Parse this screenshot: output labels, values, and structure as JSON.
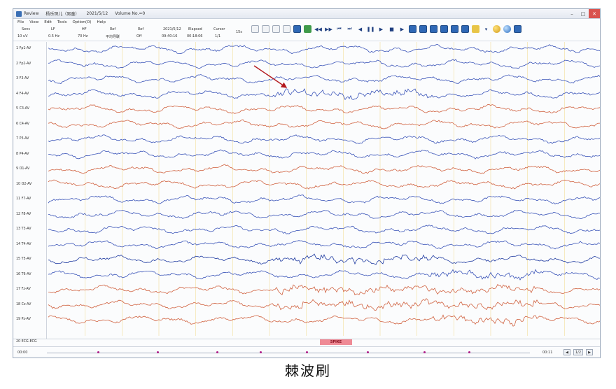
{
  "window": {
    "title_parts": [
      "Review",
      "杨乐琛儿（男童）",
      "2021/5/12",
      "Volume No.=0"
    ]
  },
  "menu": [
    "File",
    "View",
    "Edit",
    "Tools",
    "Option(O)",
    "Help"
  ],
  "controls": {
    "labels": [
      "Sens",
      "LF",
      "HF",
      "Ref",
      "Ref",
      "2021/5/12",
      "Elapsed",
      "Cursor"
    ],
    "values": [
      "10 uV",
      "0.5 Hz",
      "70 Hz",
      "平均导联",
      "Off",
      "09:40:16",
      "00:18:06",
      "1/1"
    ],
    "speed": "15s"
  },
  "toolbar_icons": [
    {
      "name": "open-icon",
      "style": "doc",
      "glyph": ""
    },
    {
      "name": "save-icon",
      "style": "doc",
      "glyph": ""
    },
    {
      "name": "copy-icon",
      "style": "doc",
      "glyph": ""
    },
    {
      "name": "print-icon",
      "style": "doc",
      "glyph": ""
    },
    {
      "name": "montage-icon",
      "style": "img",
      "glyph": ""
    },
    {
      "name": "report-icon",
      "style": "green",
      "glyph": ""
    },
    {
      "name": "rewind-fast-icon",
      "style": "plain",
      "glyph": "◀◀"
    },
    {
      "name": "forward-fast-icon",
      "style": "plain",
      "glyph": "▶▶"
    },
    {
      "name": "skip-back-icon",
      "style": "plain",
      "glyph": "⏮"
    },
    {
      "name": "skip-forward-icon",
      "style": "plain",
      "glyph": "⏭"
    },
    {
      "name": "step-back-icon",
      "style": "plain",
      "glyph": "◀"
    },
    {
      "name": "pause-icon",
      "style": "plain",
      "glyph": "❚❚"
    },
    {
      "name": "step-forward-icon",
      "style": "plain",
      "glyph": "▶"
    },
    {
      "name": "stop-icon",
      "style": "plain",
      "glyph": "■"
    },
    {
      "name": "play-icon",
      "style": "plain",
      "glyph": "▶"
    },
    {
      "name": "spectrum-icon",
      "style": "img",
      "glyph": ""
    },
    {
      "name": "map-icon",
      "style": "img",
      "glyph": ""
    },
    {
      "name": "video-icon",
      "style": "img",
      "glyph": ""
    },
    {
      "name": "camera-icon",
      "style": "img",
      "glyph": ""
    },
    {
      "name": "mark-icon",
      "style": "img",
      "glyph": ""
    },
    {
      "name": "event-icon",
      "style": "img",
      "glyph": ""
    },
    {
      "name": "folder-icon",
      "style": "yellow",
      "glyph": ""
    },
    {
      "name": "settings-icon",
      "style": "plain",
      "glyph": "▾"
    },
    {
      "name": "bulb-icon",
      "style": "ball",
      "glyph": ""
    },
    {
      "name": "globe-icon",
      "style": "ball2",
      "glyph": ""
    },
    {
      "name": "tools-icon",
      "style": "img",
      "glyph": ""
    }
  ],
  "channels": [
    {
      "label": "1 Fp1-AV",
      "color": "#3a54b8"
    },
    {
      "label": "2 Fp2-AV",
      "color": "#3a54b8"
    },
    {
      "label": "3 F3-AV",
      "color": "#3a54b8"
    },
    {
      "label": "4 F4-AV",
      "color": "#3a54b8"
    },
    {
      "label": "5 C3-AV",
      "color": "#d0613f"
    },
    {
      "label": "6 C4-AV",
      "color": "#d0613f"
    },
    {
      "label": "7 P3-AV",
      "color": "#3a54b8"
    },
    {
      "label": "8 P4-AV",
      "color": "#3a54b8"
    },
    {
      "label": "9 O1-AV",
      "color": "#d0613f"
    },
    {
      "label": "10 O2-AV",
      "color": "#d0613f"
    },
    {
      "label": "11 F7-AV",
      "color": "#3a54b8"
    },
    {
      "label": "12 F8-AV",
      "color": "#3a54b8"
    },
    {
      "label": "13 T3-AV",
      "color": "#3a54b8"
    },
    {
      "label": "14 T4-AV",
      "color": "#3a54b8"
    },
    {
      "label": "15 T5-AV",
      "color": "#1e3aa0"
    },
    {
      "label": "16 T6-AV",
      "color": "#3a54b8"
    },
    {
      "label": "17 Fz-AV",
      "color": "#d0613f"
    },
    {
      "label": "18 Cz-AV",
      "color": "#d0613f"
    },
    {
      "label": "19 Pz-AV",
      "color": "#d0613f"
    }
  ],
  "ecg_label": "20 ECG-ECG",
  "spike_tag": "SPIKE",
  "timeline": {
    "start": "00:00",
    "end": "00:11",
    "page_buttons": [
      "◀",
      "1/2",
      "▶"
    ]
  },
  "colors": {
    "arrow": "#b3181d",
    "grid": "#f3dd9a"
  },
  "caption": "棘波刷"
}
